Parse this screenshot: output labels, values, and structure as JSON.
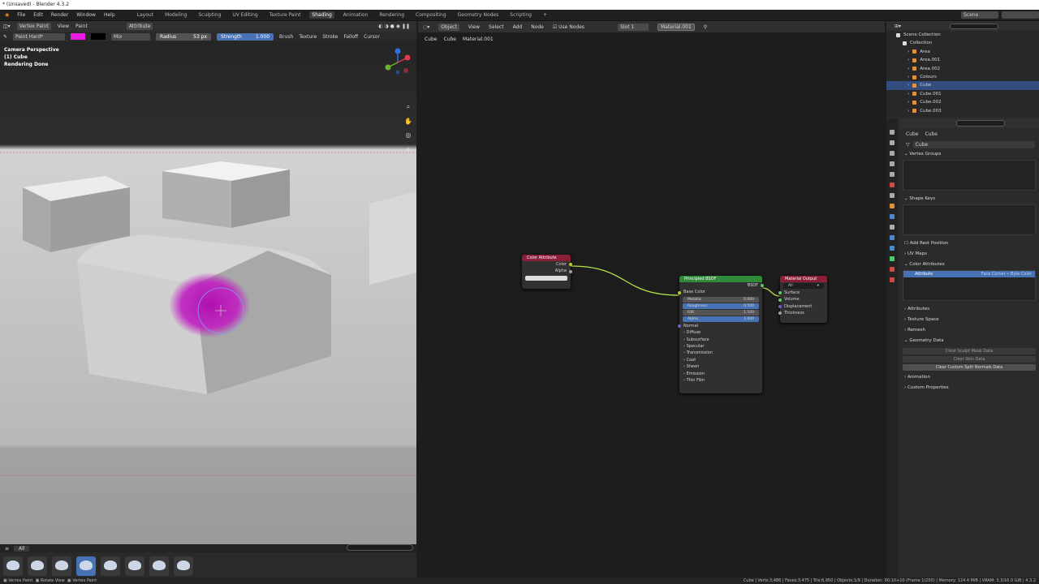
{
  "window": {
    "title": "* (Unsaved) - Blender 4.3.2"
  },
  "menu": {
    "items": [
      "File",
      "Edit",
      "Render",
      "Window",
      "Help"
    ]
  },
  "workspaces": [
    "Layout",
    "Modeling",
    "Sculpting",
    "UV Editing",
    "Texture Paint",
    "Shading",
    "Animation",
    "Rendering",
    "Compositing",
    "Geometry Nodes",
    "Scripting",
    "+"
  ],
  "viewport": {
    "mode": "Vertex Paint",
    "view": "View",
    "paint": "Paint",
    "color_source": "Attribute",
    "brush_name": "Paint Hard*",
    "blend": "Mix",
    "radius_label": "Radius",
    "radius_value": "53 px",
    "strength_label": "Strength",
    "strength_value": "1.000",
    "menus": [
      "Brush",
      "Texture",
      "Stroke",
      "Falloff",
      "Cursor"
    ],
    "overlay": [
      "Camera Perspective",
      "(1) Cube",
      "Rendering Done"
    ],
    "asset_tab": "All"
  },
  "node_editor": {
    "object_mode": "Object",
    "menus": [
      "View",
      "Select",
      "Add",
      "Node"
    ],
    "use_nodes": "Use Nodes",
    "slot": "Slot 1",
    "material": "Material.001",
    "breadcrumb": [
      "Cube",
      "Cube",
      "Material.001"
    ],
    "color_attribute": {
      "title": "Color Attribute",
      "outputs": [
        "Color",
        "Alpha"
      ]
    },
    "bsdf": {
      "title": "Principled BSDF",
      "output": "BSDF",
      "base": "Base Color",
      "fields": [
        {
          "label": "Metallic",
          "value": "0.000"
        },
        {
          "label": "Roughness",
          "value": "0.500"
        },
        {
          "label": "IOR",
          "value": "1.500"
        },
        {
          "label": "Alpha",
          "value": "1.000"
        }
      ],
      "normal": "Normal",
      "panels": [
        "Diffuse",
        "Subsurface",
        "Specular",
        "Transmission",
        "Coat",
        "Sheen",
        "Emission",
        "Thin Film"
      ]
    },
    "output": {
      "title": "Material Output",
      "target": "All",
      "inputs": [
        "Surface",
        "Volume",
        "Displacement",
        "Thickness"
      ]
    }
  },
  "outliner": {
    "scene": "Scene",
    "root": "Scene Collection",
    "collection": "Collection",
    "items": [
      "Area",
      "Area.001",
      "Area.002",
      "Colours",
      "Cube",
      "Cube.001",
      "Cube.002",
      "Cube.003"
    ]
  },
  "properties": {
    "breadcrumb": [
      "Cube",
      "Cube"
    ],
    "mesh_name": "Cube",
    "vertex_groups": "Vertex Groups",
    "shape_keys": "Shape Keys",
    "add_rest": "Add Rest Position",
    "uv_maps": "UV Maps",
    "color_attributes": "Color Attributes",
    "attr_name": "Attribute",
    "attr_domain": "Face Corner ∙ Byte Color",
    "attributes": "Attributes",
    "texture_space": "Texture Space",
    "remesh": "Remesh",
    "geometry_data": "Geometry Data",
    "clear_sculpt": "Clear Sculpt Mask Data",
    "clear_skin": "Clear Skin Data",
    "clear_split": "Clear Custom Split Normals Data",
    "animation": "Animation",
    "custom_props": "Custom Properties"
  },
  "status": {
    "left": [
      "Vertex Paint",
      "Rotate View",
      "Vertex Paint"
    ],
    "right": "Cube | Verts:3,486 | Faces:3,475 | Tris:6,950 | Objects:1/9 | Duration: 00:10+10 (Frame 1/250) | Memory: 124.4 MiB | VRAM: 3.3/16.0 GiB | 4.3.2"
  },
  "colors": {
    "accent": "#4772b3",
    "paint": "#e81ce4",
    "shader_header": "#8a1f3a",
    "bsdf_header": "#2f8a3a",
    "link": "#b6e04a"
  }
}
